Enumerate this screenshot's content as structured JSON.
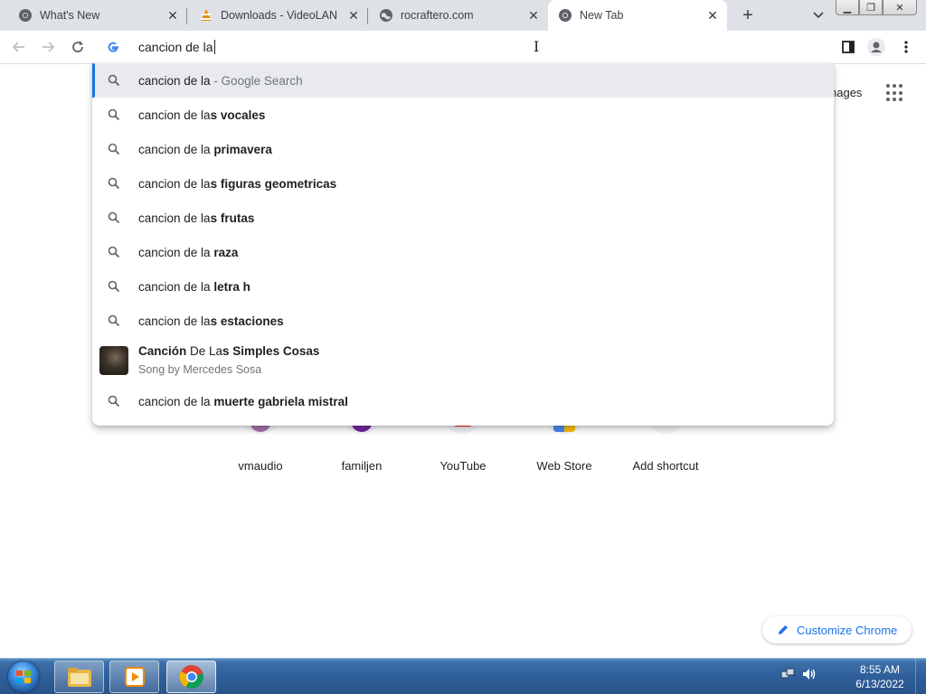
{
  "tabs": [
    {
      "title": "What's New",
      "icon": "chrome-icon"
    },
    {
      "title": "Downloads - VideoLAN",
      "icon": "vlc-icon"
    },
    {
      "title": "rocraftero.com",
      "icon": "globe-icon"
    },
    {
      "title": "New Tab",
      "icon": "chrome-icon",
      "active": true
    }
  ],
  "omnibox": {
    "text": "cancion de la"
  },
  "suggestions": [
    {
      "prefix": "cancion de la",
      "bold": "",
      "desc": " - Google Search"
    },
    {
      "prefix": "cancion de la",
      "bold": "s vocales"
    },
    {
      "prefix": "cancion de la ",
      "bold": "primavera"
    },
    {
      "prefix": "cancion de la",
      "bold": "s figuras geometricas"
    },
    {
      "prefix": "cancion de la",
      "bold": "s frutas"
    },
    {
      "prefix": "cancion de la ",
      "bold": "raza"
    },
    {
      "prefix": "cancion de la ",
      "bold": "letra h"
    },
    {
      "prefix": "cancion de la",
      "bold": "s estaciones"
    },
    {
      "prefix": "cancion de la ",
      "bold": "muerte gabriela mistral"
    }
  ],
  "entity": {
    "title_part1": "Canción",
    "title_part2": " De La",
    "title_part3": "s Simples Cosas",
    "subtitle": "Song by Mercedes Sosa"
  },
  "page": {
    "images_link": "nages",
    "shortcuts": [
      {
        "label": "vmaudio",
        "color": "#a46aa6"
      },
      {
        "label": "familjen",
        "color": "#6a1b9a"
      },
      {
        "label": "YouTube",
        "color": "#ff0000"
      },
      {
        "label": "Web Store",
        "color": "#4285f4"
      },
      {
        "label": "Add shortcut",
        "color": "#5f6368"
      }
    ],
    "customize_label": "Customize Chrome"
  },
  "taskbar": {
    "time": "8:55 AM",
    "date": "6/13/2022"
  },
  "colors": {
    "accent": "#1a73e8",
    "tabstrip": "#dee1e6",
    "selected_row": "#e8eaed"
  }
}
